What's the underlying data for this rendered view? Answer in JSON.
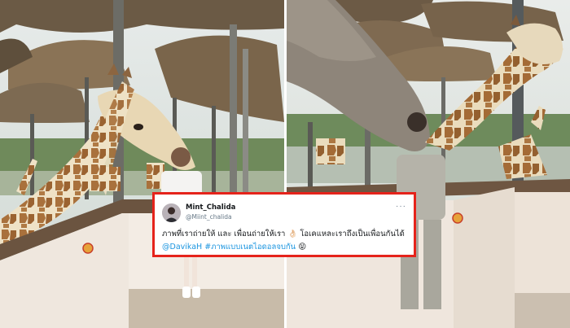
{
  "tweet": {
    "display_name": "Mint_Chalida",
    "handle": "@Miint_chalida",
    "more_menu": "···",
    "text_part1": "ภาพที่เราถ่ายให้ และ เพื่อนถ่ายให้เรา",
    "emoji_hand": "👌🏻",
    "text_part2": "โอเคแหละเราถึงเป็นเพื่อนกันได้",
    "mention": "@DavikaH",
    "hashtag": "#ภาพแบบเนตไอดอลจบกัน",
    "emoji_face": "😝"
  },
  "colors": {
    "frame_border": "#e5231b",
    "link": "#1b95e0",
    "name_text": "#14171a",
    "handle_text": "#657786"
  },
  "photos": {
    "left": "photo-giraffes-feeding-with-woman-standing",
    "right": "photo-giraffe-nuzzling-woman"
  }
}
